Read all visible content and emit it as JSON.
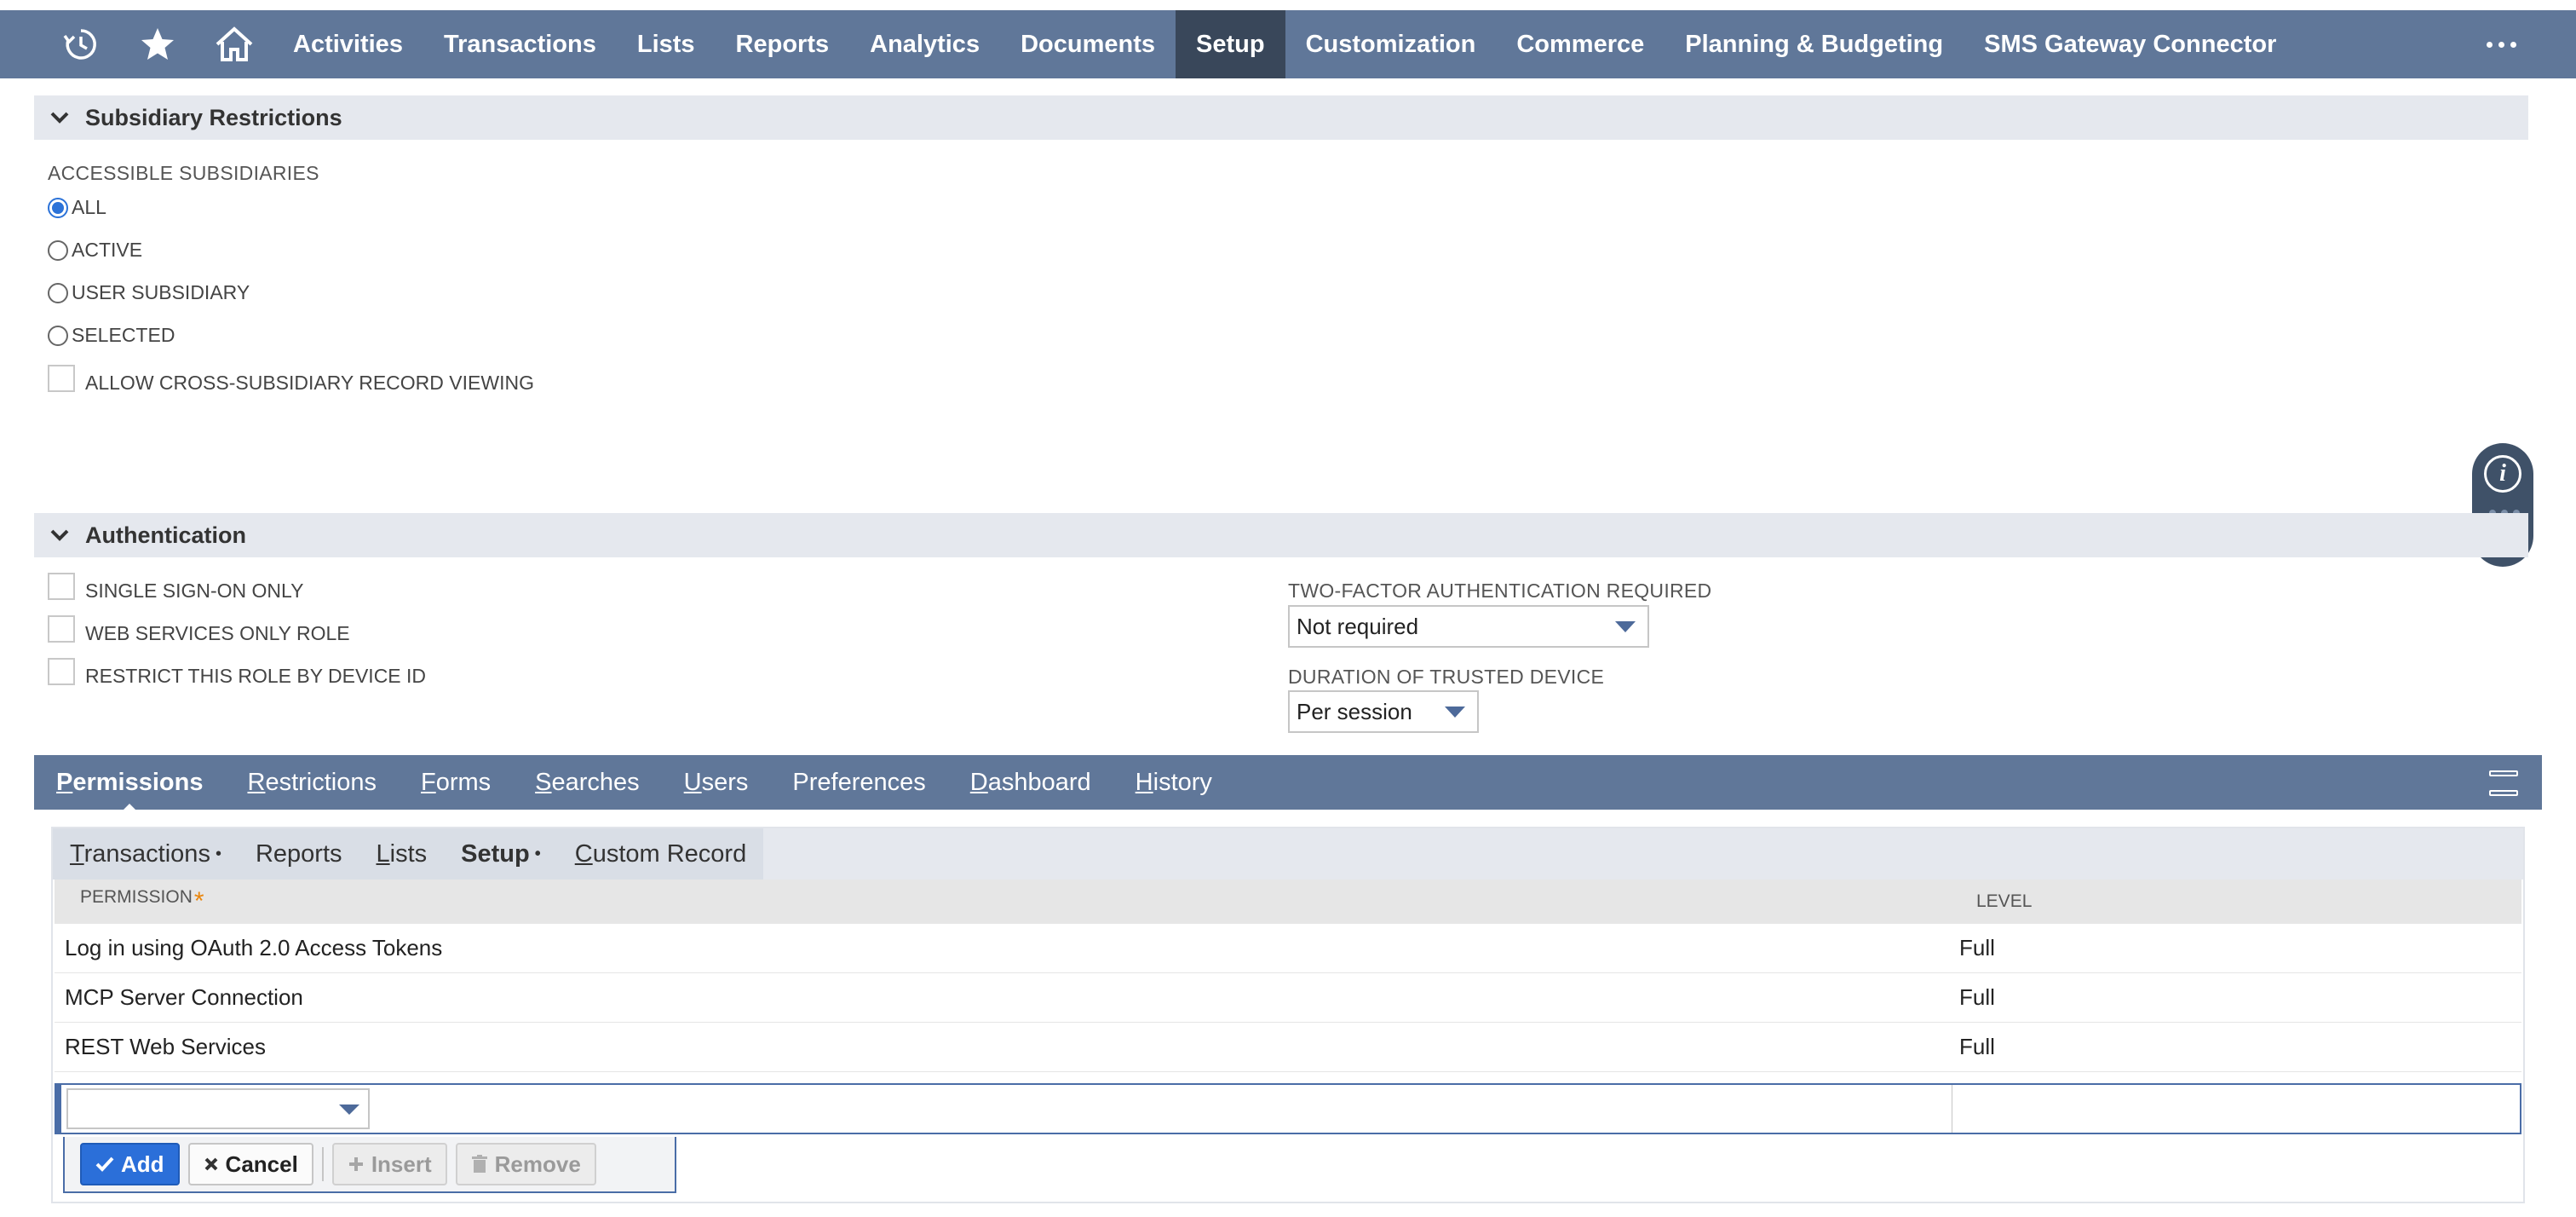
{
  "top_nav": {
    "icons": [
      "recent-icon",
      "star-icon",
      "home-icon"
    ],
    "items": [
      "Activities",
      "Transactions",
      "Lists",
      "Reports",
      "Analytics",
      "Documents",
      "Setup",
      "Customization",
      "Commerce",
      "Planning & Budgeting",
      "SMS Gateway Connector"
    ],
    "active": "Setup"
  },
  "subsidiary": {
    "title": "Subsidiary Restrictions",
    "field_label": "ACCESSIBLE SUBSIDIARIES",
    "options": [
      "ALL",
      "ACTIVE",
      "USER SUBSIDIARY",
      "SELECTED"
    ],
    "selected": "ALL",
    "cross_label": "ALLOW CROSS-SUBSIDIARY RECORD VIEWING"
  },
  "authentication": {
    "title": "Authentication",
    "checkboxes": [
      "SINGLE SIGN-ON ONLY",
      "WEB SERVICES ONLY ROLE",
      "RESTRICT THIS ROLE BY DEVICE ID"
    ],
    "two_factor_label": "TWO-FACTOR AUTHENTICATION REQUIRED",
    "two_factor_value": "Not required",
    "duration_label": "DURATION OF TRUSTED DEVICE",
    "duration_value": "Per session"
  },
  "tabs": {
    "items": [
      "Permissions",
      "Restrictions",
      "Forms",
      "Searches",
      "Users",
      "Preferences",
      "Dashboard",
      "History"
    ],
    "active": "Permissions"
  },
  "subtabs": {
    "items": [
      {
        "label": "Transactions",
        "dot": "•"
      },
      {
        "label": "Reports",
        "dot": ""
      },
      {
        "label": "Lists",
        "dot": ""
      },
      {
        "label": "Setup",
        "dot": "•"
      },
      {
        "label": "Custom Record",
        "dot": ""
      }
    ],
    "active": "Setup"
  },
  "permissions_table": {
    "headers": {
      "permission": "PERMISSION",
      "required_mark": "*",
      "level": "LEVEL"
    },
    "rows": [
      {
        "permission": "Log in using OAuth 2.0 Access Tokens",
        "level": "Full"
      },
      {
        "permission": "MCP Server Connection",
        "level": "Full"
      },
      {
        "permission": "REST Web Services",
        "level": "Full"
      }
    ]
  },
  "buttons": {
    "add": "Add",
    "cancel": "Cancel",
    "insert": "Insert",
    "remove": "Remove"
  },
  "colors": {
    "nav_bg": "#607799",
    "nav_active": "#39475a",
    "primary_button": "#2b6fd9",
    "required_mark": "#e9860e"
  }
}
